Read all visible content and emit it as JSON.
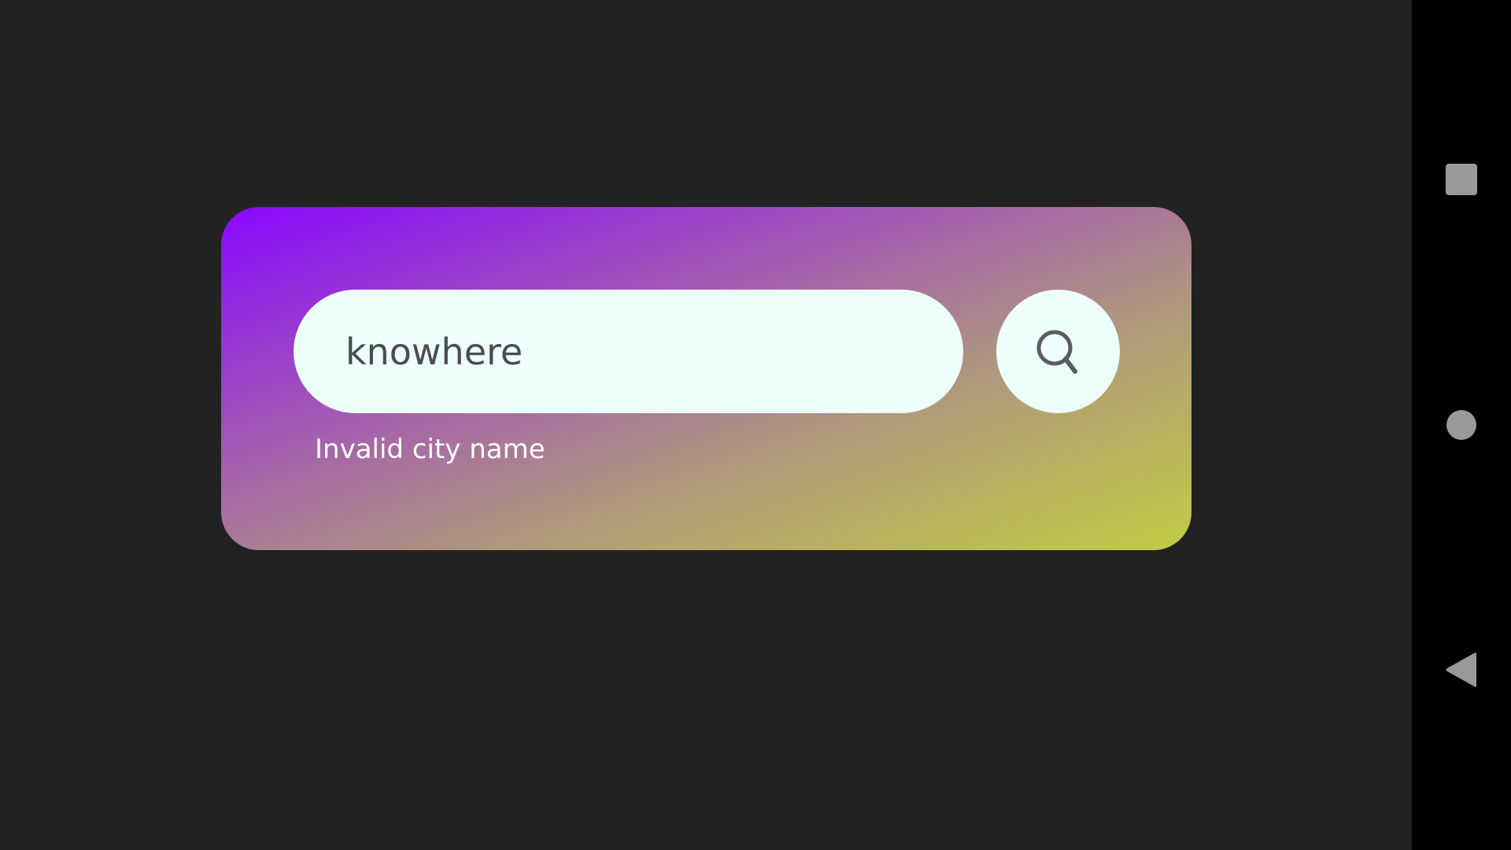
{
  "search": {
    "value": "knowhere",
    "placeholder": ""
  },
  "error": {
    "message": "Invalid city name"
  },
  "icons": {
    "search": "search-icon",
    "recents": "square-icon",
    "home": "circle-icon",
    "back": "triangle-back-icon"
  },
  "colors": {
    "background": "#222222",
    "gradient_start": "#8a07ff",
    "gradient_end": "#c2cb43",
    "field_background": "#ecfffb",
    "error_text": "#ffffff",
    "nav_bar": "#000000",
    "nav_icon": "#9a9a9a"
  }
}
